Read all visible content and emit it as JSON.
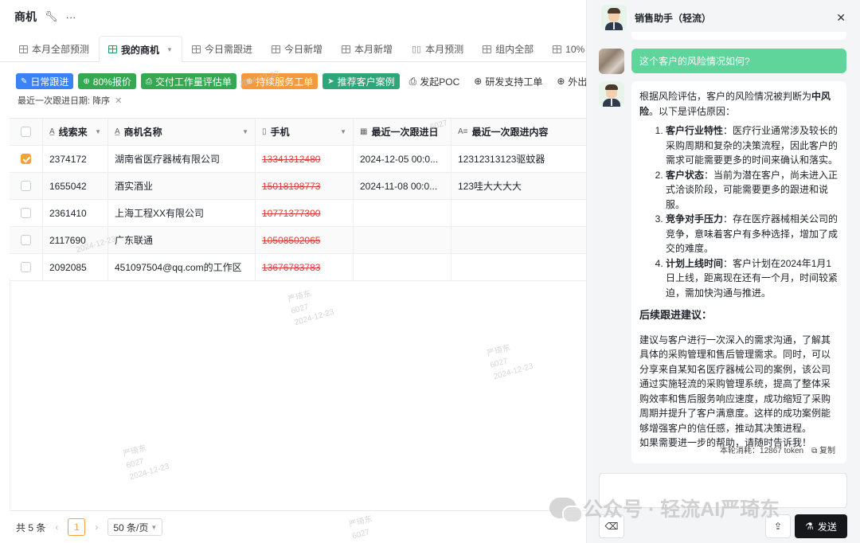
{
  "app": {
    "title": "商机",
    "wrench_icon": "wrench-icon",
    "more_icon": "more-icon"
  },
  "tabs": [
    {
      "label": "本月全部预测",
      "icon": "grid-icon"
    },
    {
      "label": "我的商机",
      "icon": "grid-icon",
      "active": true
    },
    {
      "label": "今日需跟进",
      "icon": "grid-icon"
    },
    {
      "label": "今日新增",
      "icon": "grid-icon"
    },
    {
      "label": "本月新增",
      "icon": "grid-icon"
    },
    {
      "label": "本月预测",
      "icon": "board-icon"
    },
    {
      "label": "组内全部",
      "icon": "grid-icon"
    },
    {
      "label": "10%",
      "icon": "grid-icon"
    }
  ],
  "actions": {
    "daily": "日常跟进",
    "quote80": "80%报价",
    "deliver": "交付工作量评估单",
    "service": "持续服务工单",
    "recommend": "推荐客户案例",
    "poc": "发起POC",
    "rnd": "研发支持工单",
    "visit": "外出访问"
  },
  "sort_chip": "最近一次跟进日期: 降序",
  "table": {
    "headers": [
      "线索来",
      "商机名称",
      "手机",
      "最近一次跟进日",
      "最近一次跟进内容"
    ],
    "rows": [
      {
        "id": "2374172",
        "name": "湖南省医疗器械有限公司",
        "phone": "13341312480",
        "date": "2024-12-05 00:0...",
        "content": "12312313123驱蚊器",
        "checked": true
      },
      {
        "id": "1655042",
        "name": "酒实酒业",
        "phone": "15018198773",
        "date": "2024-11-08 00:0...",
        "content": "123哇大大大大",
        "checked": false
      },
      {
        "id": "2361410",
        "name": "上海工程XX有限公司",
        "phone": "10771377300",
        "date": "",
        "content": "",
        "checked": false
      },
      {
        "id": "2117690",
        "name": "广东联通",
        "phone": "10508502065",
        "date": "",
        "content": "",
        "checked": false
      },
      {
        "id": "2092085",
        "name": "451097504@qq.com的工作区",
        "phone": "13676783783",
        "date": "",
        "content": "",
        "checked": false
      }
    ]
  },
  "pager": {
    "total": "共 5 条",
    "page": "1",
    "size": "50 条/页"
  },
  "watermark": {
    "name": "严琦东",
    "code": "6027",
    "date": "2024-12-23"
  },
  "panel": {
    "title": "销售助手（轻流）",
    "user_question": "这个客户的风险情况如何?",
    "answer_intro_a": "根据风险评估，客户的风险情况被判断为",
    "answer_intro_b": "中风险",
    "answer_intro_c": "。以下是评估原因：",
    "reasons": [
      {
        "title": "客户行业特性",
        "text": "：医疗行业通常涉及较长的采购周期和复杂的决策流程，因此客户的需求可能需要更多的时间来确认和落实。"
      },
      {
        "title": "客户状态",
        "text": "：当前为潜在客户，尚未进入正式洽谈阶段，可能需要更多的跟进和说服。"
      },
      {
        "title": "竞争对手压力",
        "text": "：存在医疗器械相关公司的竞争，意味着客户有多种选择，增加了成交的难度。"
      },
      {
        "title": "计划上线时间",
        "text": "：客户计划在2024年1月1日上线，距离现在还有一个月，时间较紧迫，需加快沟通与推进。"
      }
    ],
    "followup_title": "后续跟进建议：",
    "followup_text": "建议与客户进行一次深入的需求沟通，了解其具体的采购管理和售后管理需求。同时，可以分享来自某知名医疗器械公司的案例，该公司通过实施轻流的采购管理系统，提高了整体采购效率和售后服务响应速度，成功缩短了采购周期并提升了客户满意度。这样的成功案例能够增强客户的信任感，推动其决策进程。",
    "closing_text": "如果需要进一步的帮助，请随时告诉我！",
    "token_usage": "本轮消耗：12867 token",
    "copy_label": "复制",
    "send_label": "发送"
  },
  "brand_watermark": "公众号 · 轻流AI严琦东",
  "colors": {
    "accent_green": "#20a162",
    "user_bubble": "#5fd49b",
    "strike_red": "#e23b3b",
    "checkbox_orange": "#f5a03a"
  }
}
